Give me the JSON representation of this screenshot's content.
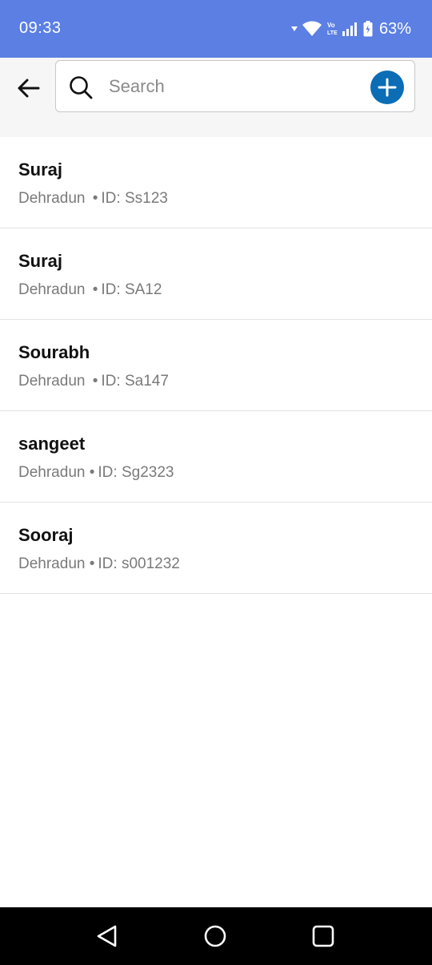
{
  "status_bar": {
    "time": "09:33",
    "battery_percent": "63%",
    "icons": [
      "wifi-icon",
      "volte-icon",
      "signal-icon",
      "battery-icon"
    ]
  },
  "search": {
    "placeholder": "Search",
    "value": ""
  },
  "contacts": [
    {
      "name": "Suraj",
      "city": "Dehradun",
      "separator": "•",
      "id": "ID: Ss123"
    },
    {
      "name": "Suraj",
      "city": "Dehradun",
      "separator": "•",
      "id": "ID: SA12"
    },
    {
      "name": "Sourabh",
      "city": "Dehradun",
      "separator": "•",
      "id": "ID: Sa147"
    },
    {
      "name": "sangeet",
      "city": "Dehradun",
      "separator": "•",
      "id": "ID: Sg2323"
    },
    {
      "name": "Sooraj",
      "city": "Dehradun",
      "separator": "•",
      "id": "ID: s001232"
    }
  ],
  "colors": {
    "status_bar": "#5b7fe3",
    "accent": "#0a6db5",
    "header_bg": "#f6f6f6",
    "nav_bar": "#000000"
  },
  "nav_bar": {
    "icons": [
      "back-triangle-icon",
      "home-circle-icon",
      "recents-square-icon"
    ]
  }
}
